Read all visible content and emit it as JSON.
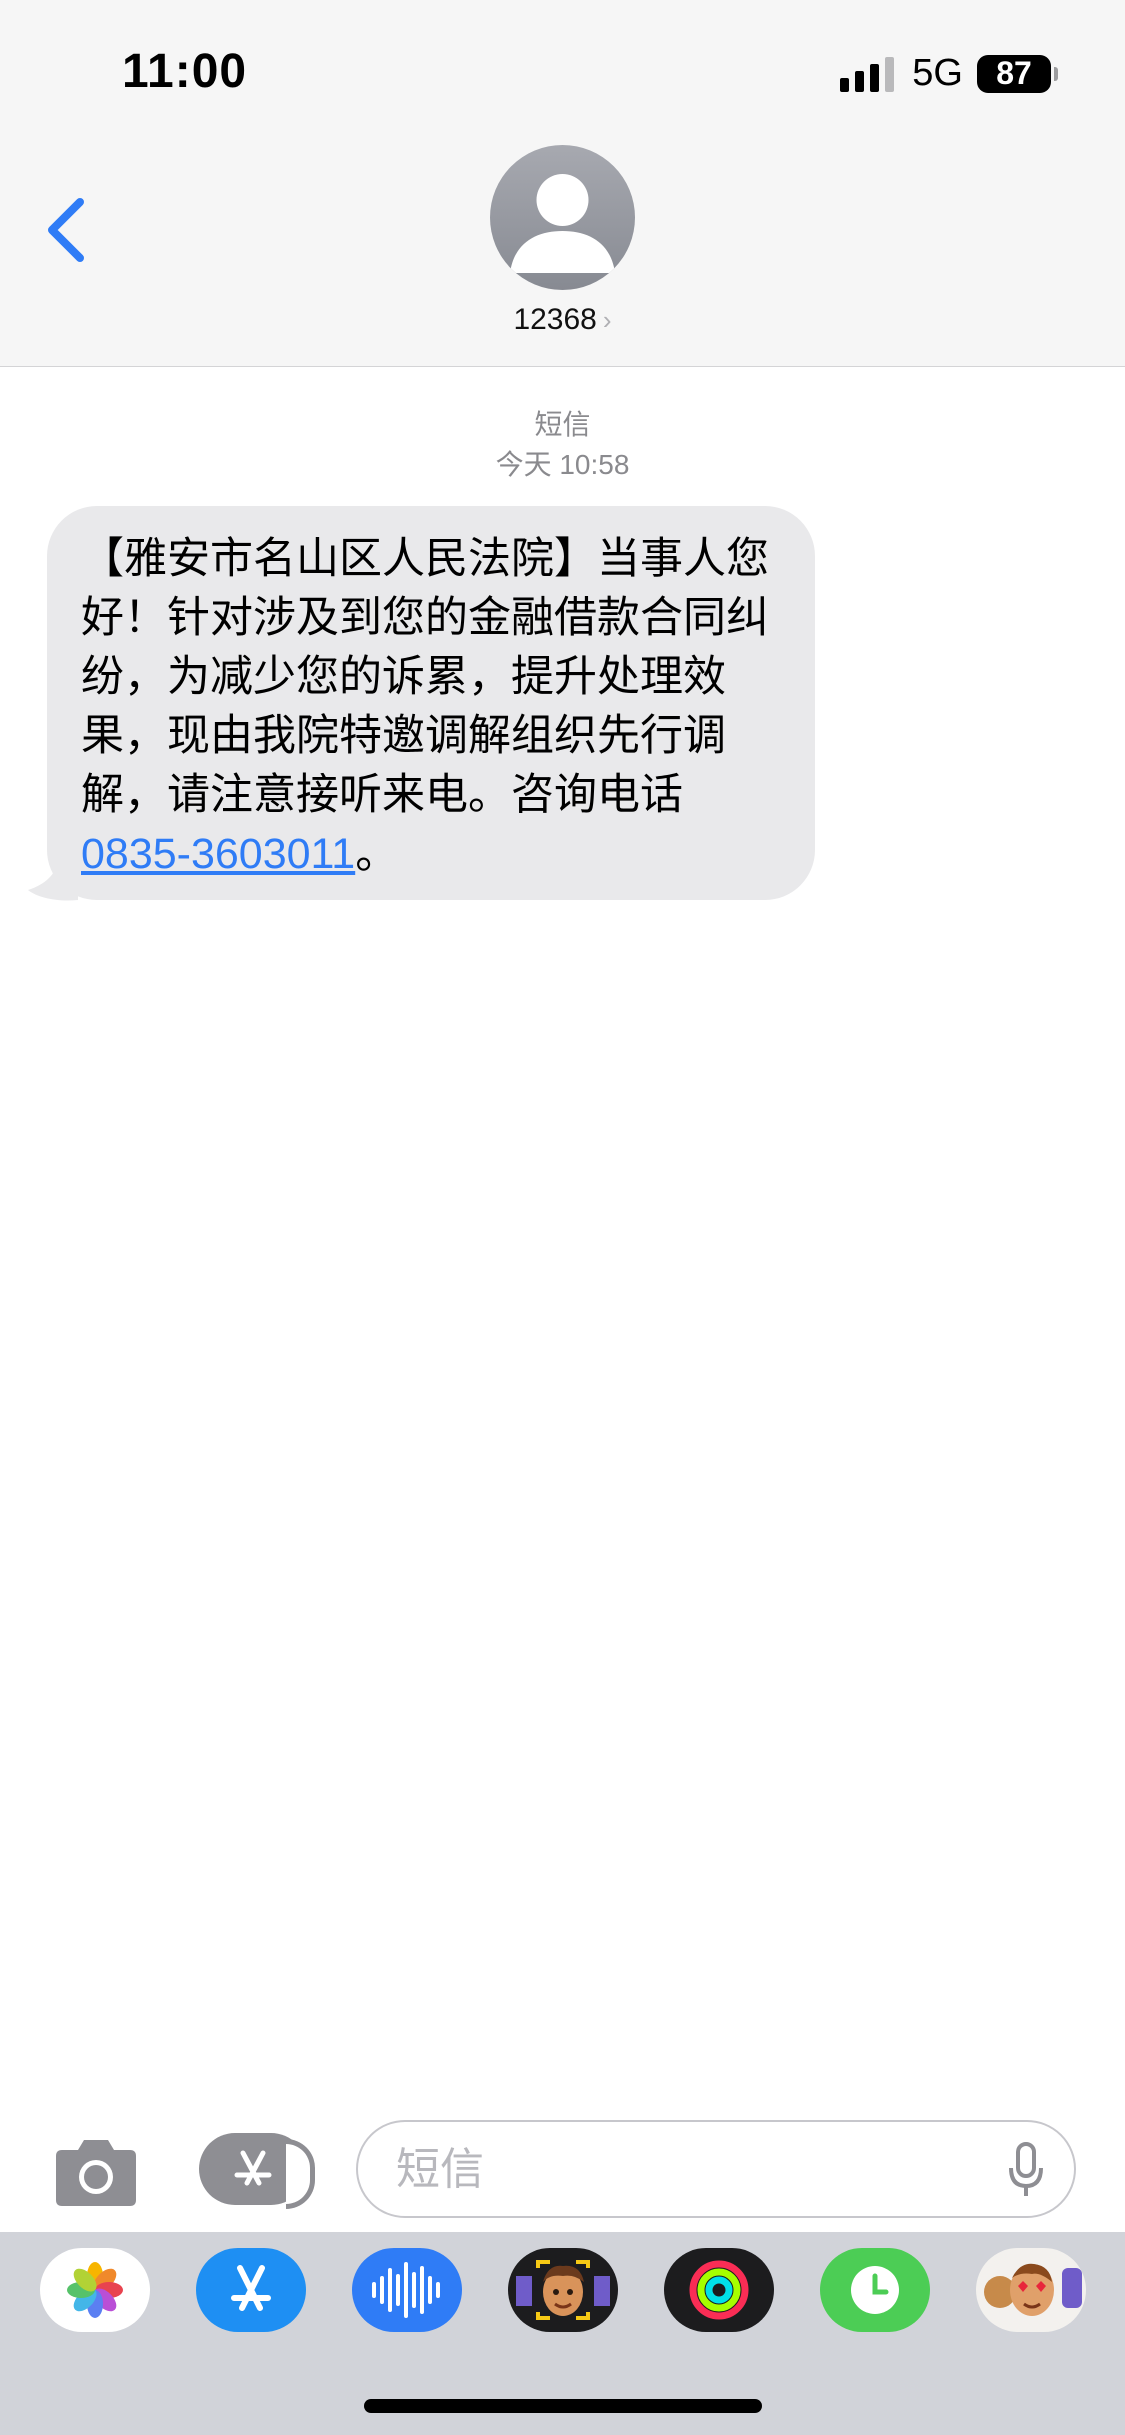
{
  "status_bar": {
    "time": "11:00",
    "network": "5G",
    "battery": "87"
  },
  "header": {
    "contact_number": "12368"
  },
  "conversation": {
    "service_label": "短信",
    "timestamp": "今天 10:58",
    "message": {
      "text_before_link": "【雅安市名山区人民法院】当事人您好！针对涉及到您的金融借款合同纠纷，为减少您的诉累，提升处理效果，现由我院特邀调解组织先行调解，请注意接听来电。咨询电话 ",
      "phone_link": "0835-3603011",
      "text_after_link": "。"
    }
  },
  "input_bar": {
    "placeholder": "短信"
  },
  "app_drawer": {
    "apps": [
      "photos-app",
      "app-store-app",
      "voice-memo-app",
      "memoji-app",
      "fitness-app",
      "clock-app",
      "stickers-app"
    ]
  },
  "colors": {
    "link": "#2f7cf6",
    "back_chevron": "#2f7cf6",
    "bubble": "#e9e9eb"
  }
}
